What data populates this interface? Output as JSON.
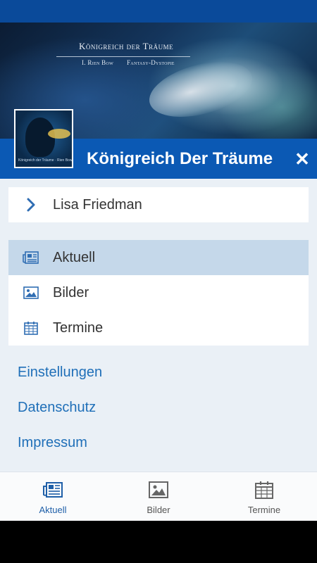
{
  "banner": {
    "title": "Königreich der Träume",
    "subtitle_left": "I. Rien Bow",
    "subtitle_right": "Fantasy-Dystopie"
  },
  "cover": {
    "tagline": "Königreich der Träume · Rien Bow"
  },
  "header": {
    "title": "Königreich Der Träume",
    "close": "✕"
  },
  "author": {
    "name": "Lisa Friedman"
  },
  "menu": {
    "items": [
      {
        "label": "Aktuell",
        "icon": "newspaper-icon",
        "active": true
      },
      {
        "label": "Bilder",
        "icon": "image-icon",
        "active": false
      },
      {
        "label": "Termine",
        "icon": "calendar-icon",
        "active": false
      }
    ]
  },
  "links": {
    "settings": "Einstellungen",
    "privacy": "Datenschutz",
    "imprint": "Impressum"
  },
  "tabs": [
    {
      "label": "Aktuell",
      "icon": "newspaper-icon",
      "active": true
    },
    {
      "label": "Bilder",
      "icon": "image-icon",
      "active": false
    },
    {
      "label": "Termine",
      "icon": "calendar-icon",
      "active": false
    }
  ],
  "colors": {
    "brand_blue": "#0b59b4",
    "link_blue": "#1f6fb8",
    "active_row": "#c5d8ea",
    "background": "#eaf0f6"
  }
}
